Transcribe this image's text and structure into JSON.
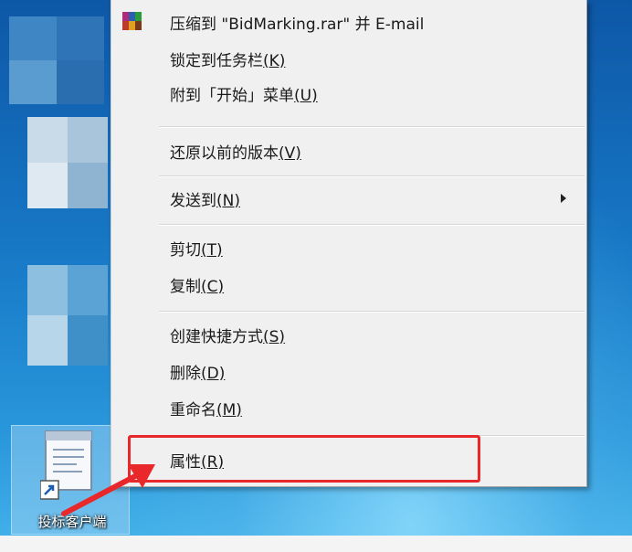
{
  "context_menu": {
    "items": [
      {
        "text": "压缩到 \"BidMarking.rar\" 并 E-mail",
        "key": ""
      },
      {
        "text": "锁定到任务栏",
        "key": "(K)"
      },
      {
        "text": "附到「开始」菜单",
        "key": "(U)"
      },
      {
        "text": "还原以前的版本",
        "key": "(V)"
      },
      {
        "text": "发送到",
        "key": "(N)"
      },
      {
        "text": "剪切",
        "key": "(T)"
      },
      {
        "text": "复制",
        "key": "(C)"
      },
      {
        "text": "创建快捷方式",
        "key": "(S)"
      },
      {
        "text": "删除",
        "key": "(D)"
      },
      {
        "text": "重命名",
        "key": "(M)"
      },
      {
        "text": "属性",
        "key": "(R)"
      }
    ],
    "icons": {
      "compress_item": "winrar-icon",
      "send_to": "submenu-arrow-icon"
    }
  },
  "desktop": {
    "selected_icon_label": "投标客户端",
    "selected_icon": "document-shortcut-icon"
  },
  "annotation": {
    "highlight_color": "#e8282a",
    "pointer": "red-arrow-icon"
  }
}
